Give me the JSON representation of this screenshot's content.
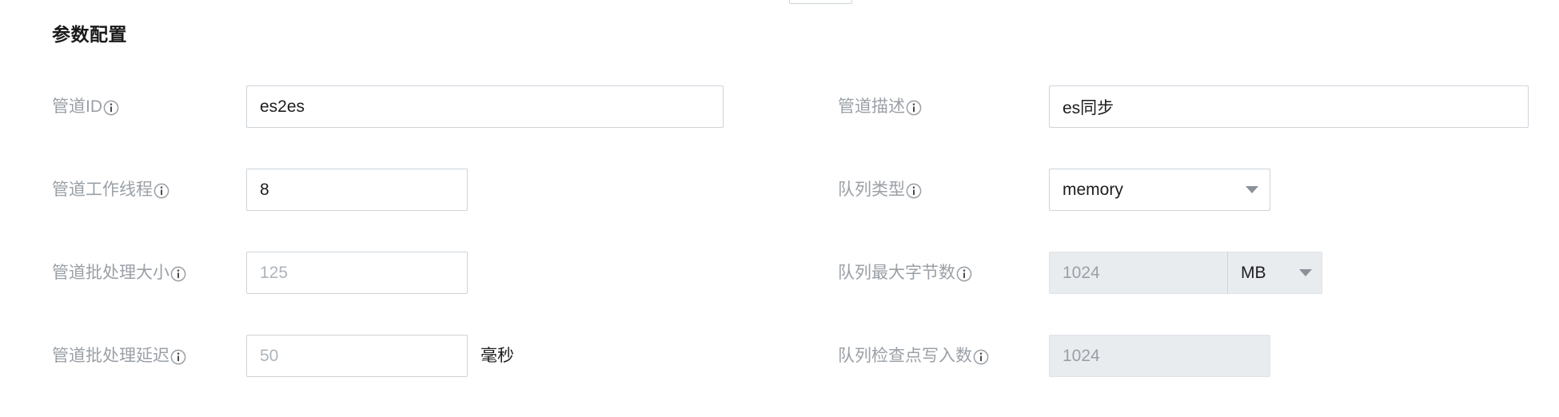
{
  "section": {
    "title": "参数配置"
  },
  "fields": {
    "pipeline_id": {
      "label": "管道ID",
      "value": "es2es",
      "placeholder": ""
    },
    "pipeline_desc": {
      "label": "管道描述",
      "value": "es同步",
      "placeholder": ""
    },
    "worker_threads": {
      "label": "管道工作线程",
      "value": "8",
      "placeholder": ""
    },
    "queue_type": {
      "label": "队列类型",
      "value": "memory"
    },
    "batch_size": {
      "label": "管道批处理大小",
      "value": "",
      "placeholder": "125"
    },
    "queue_max_bytes": {
      "label": "队列最大字节数",
      "value": "",
      "placeholder": "1024",
      "unit": "MB"
    },
    "batch_delay": {
      "label": "管道批处理延迟",
      "value": "",
      "placeholder": "50",
      "suffix": "毫秒"
    },
    "queue_checkpoint_writes": {
      "label": "队列检查点写入数",
      "value": "",
      "placeholder": "1024"
    }
  },
  "icons": {
    "info": "info-circle-icon",
    "caret": "chevron-down-icon"
  },
  "colors": {
    "border": "#ced4da",
    "label_text": "#9aa0a6",
    "value_text": "#1d1d1f",
    "disabled_fill": "#e9ecef",
    "placeholder_text": "#adb5bd",
    "heading_text": "#1a1a1a",
    "background": "#ffffff"
  }
}
